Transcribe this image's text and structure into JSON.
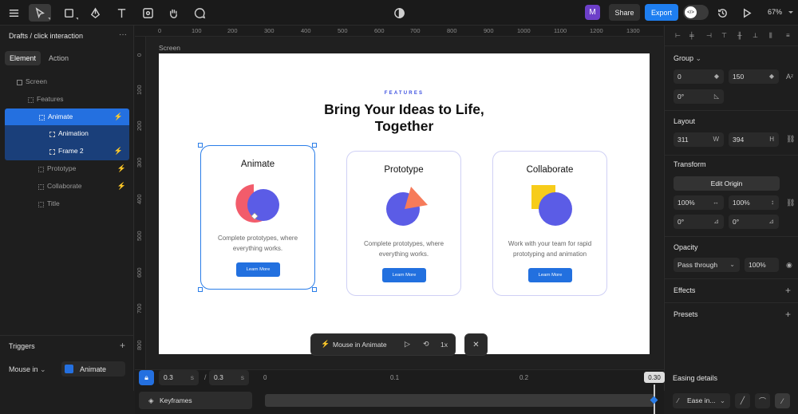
{
  "topbar": {
    "avatar": "M",
    "share": "Share",
    "export": "Export",
    "toggle_icon": "</>",
    "zoom": "67%"
  },
  "left": {
    "project_title": "Drafts / click interaction",
    "more": "···",
    "tabs": [
      "Element",
      "Action"
    ],
    "layers": [
      {
        "label": "Screen"
      },
      {
        "label": "Features"
      },
      {
        "label": "Animate"
      },
      {
        "label": "Animation"
      },
      {
        "label": "Frame 2"
      },
      {
        "label": "Prototype"
      },
      {
        "label": "Collaborate"
      },
      {
        "label": "Title"
      }
    ],
    "triggers_title": "Triggers",
    "trigger_event": "Mouse in",
    "trigger_target": "Animate"
  },
  "canvas": {
    "screen_label": "Screen",
    "ruler_x": [
      "0",
      "100",
      "200",
      "300",
      "400",
      "500",
      "600",
      "700",
      "800",
      "900",
      "1000",
      "1100",
      "1200",
      "1300"
    ],
    "ruler_y": [
      "0",
      "100",
      "200",
      "300",
      "400",
      "500",
      "600",
      "700",
      "800"
    ],
    "eyebrow": "FEATURES",
    "heading_line1": "Bring Your Ideas to Life,",
    "heading_line2": "Together",
    "cards": [
      {
        "title": "Animate",
        "desc1": "Complete prototypes, where",
        "desc2": "everything works.",
        "button": "Learn More"
      },
      {
        "title": "Prototype",
        "desc1": "Complete prototypes, where",
        "desc2": "everything works.",
        "button": "Learn More"
      },
      {
        "title": "Collaborate",
        "desc1": "Work with your team for rapid",
        "desc2": "prototyping and animation",
        "button": "Learn More"
      }
    ],
    "floating": {
      "label": "Mouse in Animate",
      "speed": "1x",
      "close": "✕"
    }
  },
  "right": {
    "group_title": "Group",
    "x": "0",
    "y": "150",
    "rotation": "0°",
    "layout_title": "Layout",
    "width": "311",
    "width_suffix": "W",
    "height": "394",
    "height_suffix": "H",
    "transform_title": "Transform",
    "edit_origin": "Edit Origin",
    "scale_x": "100%",
    "scale_y": "100%",
    "skew_x": "0°",
    "skew_y": "0°",
    "opacity_title": "Opacity",
    "blend": "Pass through",
    "opacity": "100%",
    "effects_title": "Effects",
    "presets_title": "Presets"
  },
  "timeline": {
    "delay": "0.3",
    "delay_unit": "s",
    "duration": "0.3",
    "duration_unit": "s",
    "slash": "/",
    "keyframes": "Keyframes",
    "ticks": [
      "0",
      "0.1",
      "0.2"
    ],
    "end": "0.30",
    "easing_title": "Easing details",
    "ease": "Ease in..."
  },
  "colors": {
    "accent": "#2470e0",
    "brand": "#6d3fc9",
    "coral": "#f25c6b",
    "indigo": "#5b5ce6",
    "orange": "#f67b5a",
    "yellow": "#f7cc1b"
  }
}
